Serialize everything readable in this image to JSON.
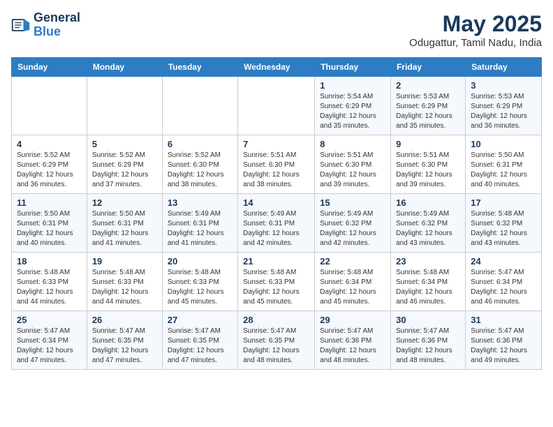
{
  "logo": {
    "line1": "General",
    "line2": "Blue"
  },
  "title": "May 2025",
  "location": "Odugattur, Tamil Nadu, India",
  "weekdays": [
    "Sunday",
    "Monday",
    "Tuesday",
    "Wednesday",
    "Thursday",
    "Friday",
    "Saturday"
  ],
  "weeks": [
    [
      {
        "day": "",
        "info": ""
      },
      {
        "day": "",
        "info": ""
      },
      {
        "day": "",
        "info": ""
      },
      {
        "day": "",
        "info": ""
      },
      {
        "day": "1",
        "info": "Sunrise: 5:54 AM\nSunset: 6:29 PM\nDaylight: 12 hours\nand 35 minutes."
      },
      {
        "day": "2",
        "info": "Sunrise: 5:53 AM\nSunset: 6:29 PM\nDaylight: 12 hours\nand 35 minutes."
      },
      {
        "day": "3",
        "info": "Sunrise: 5:53 AM\nSunset: 6:29 PM\nDaylight: 12 hours\nand 36 minutes."
      }
    ],
    [
      {
        "day": "4",
        "info": "Sunrise: 5:52 AM\nSunset: 6:29 PM\nDaylight: 12 hours\nand 36 minutes."
      },
      {
        "day": "5",
        "info": "Sunrise: 5:52 AM\nSunset: 6:29 PM\nDaylight: 12 hours\nand 37 minutes."
      },
      {
        "day": "6",
        "info": "Sunrise: 5:52 AM\nSunset: 6:30 PM\nDaylight: 12 hours\nand 38 minutes."
      },
      {
        "day": "7",
        "info": "Sunrise: 5:51 AM\nSunset: 6:30 PM\nDaylight: 12 hours\nand 38 minutes."
      },
      {
        "day": "8",
        "info": "Sunrise: 5:51 AM\nSunset: 6:30 PM\nDaylight: 12 hours\nand 39 minutes."
      },
      {
        "day": "9",
        "info": "Sunrise: 5:51 AM\nSunset: 6:30 PM\nDaylight: 12 hours\nand 39 minutes."
      },
      {
        "day": "10",
        "info": "Sunrise: 5:50 AM\nSunset: 6:31 PM\nDaylight: 12 hours\nand 40 minutes."
      }
    ],
    [
      {
        "day": "11",
        "info": "Sunrise: 5:50 AM\nSunset: 6:31 PM\nDaylight: 12 hours\nand 40 minutes."
      },
      {
        "day": "12",
        "info": "Sunrise: 5:50 AM\nSunset: 6:31 PM\nDaylight: 12 hours\nand 41 minutes."
      },
      {
        "day": "13",
        "info": "Sunrise: 5:49 AM\nSunset: 6:31 PM\nDaylight: 12 hours\nand 41 minutes."
      },
      {
        "day": "14",
        "info": "Sunrise: 5:49 AM\nSunset: 6:31 PM\nDaylight: 12 hours\nand 42 minutes."
      },
      {
        "day": "15",
        "info": "Sunrise: 5:49 AM\nSunset: 6:32 PM\nDaylight: 12 hours\nand 42 minutes."
      },
      {
        "day": "16",
        "info": "Sunrise: 5:49 AM\nSunset: 6:32 PM\nDaylight: 12 hours\nand 43 minutes."
      },
      {
        "day": "17",
        "info": "Sunrise: 5:48 AM\nSunset: 6:32 PM\nDaylight: 12 hours\nand 43 minutes."
      }
    ],
    [
      {
        "day": "18",
        "info": "Sunrise: 5:48 AM\nSunset: 6:33 PM\nDaylight: 12 hours\nand 44 minutes."
      },
      {
        "day": "19",
        "info": "Sunrise: 5:48 AM\nSunset: 6:33 PM\nDaylight: 12 hours\nand 44 minutes."
      },
      {
        "day": "20",
        "info": "Sunrise: 5:48 AM\nSunset: 6:33 PM\nDaylight: 12 hours\nand 45 minutes."
      },
      {
        "day": "21",
        "info": "Sunrise: 5:48 AM\nSunset: 6:33 PM\nDaylight: 12 hours\nand 45 minutes."
      },
      {
        "day": "22",
        "info": "Sunrise: 5:48 AM\nSunset: 6:34 PM\nDaylight: 12 hours\nand 45 minutes."
      },
      {
        "day": "23",
        "info": "Sunrise: 5:48 AM\nSunset: 6:34 PM\nDaylight: 12 hours\nand 46 minutes."
      },
      {
        "day": "24",
        "info": "Sunrise: 5:47 AM\nSunset: 6:34 PM\nDaylight: 12 hours\nand 46 minutes."
      }
    ],
    [
      {
        "day": "25",
        "info": "Sunrise: 5:47 AM\nSunset: 6:34 PM\nDaylight: 12 hours\nand 47 minutes."
      },
      {
        "day": "26",
        "info": "Sunrise: 5:47 AM\nSunset: 6:35 PM\nDaylight: 12 hours\nand 47 minutes."
      },
      {
        "day": "27",
        "info": "Sunrise: 5:47 AM\nSunset: 6:35 PM\nDaylight: 12 hours\nand 47 minutes."
      },
      {
        "day": "28",
        "info": "Sunrise: 5:47 AM\nSunset: 6:35 PM\nDaylight: 12 hours\nand 48 minutes."
      },
      {
        "day": "29",
        "info": "Sunrise: 5:47 AM\nSunset: 6:36 PM\nDaylight: 12 hours\nand 48 minutes."
      },
      {
        "day": "30",
        "info": "Sunrise: 5:47 AM\nSunset: 6:36 PM\nDaylight: 12 hours\nand 48 minutes."
      },
      {
        "day": "31",
        "info": "Sunrise: 5:47 AM\nSunset: 6:36 PM\nDaylight: 12 hours\nand 49 minutes."
      }
    ]
  ]
}
